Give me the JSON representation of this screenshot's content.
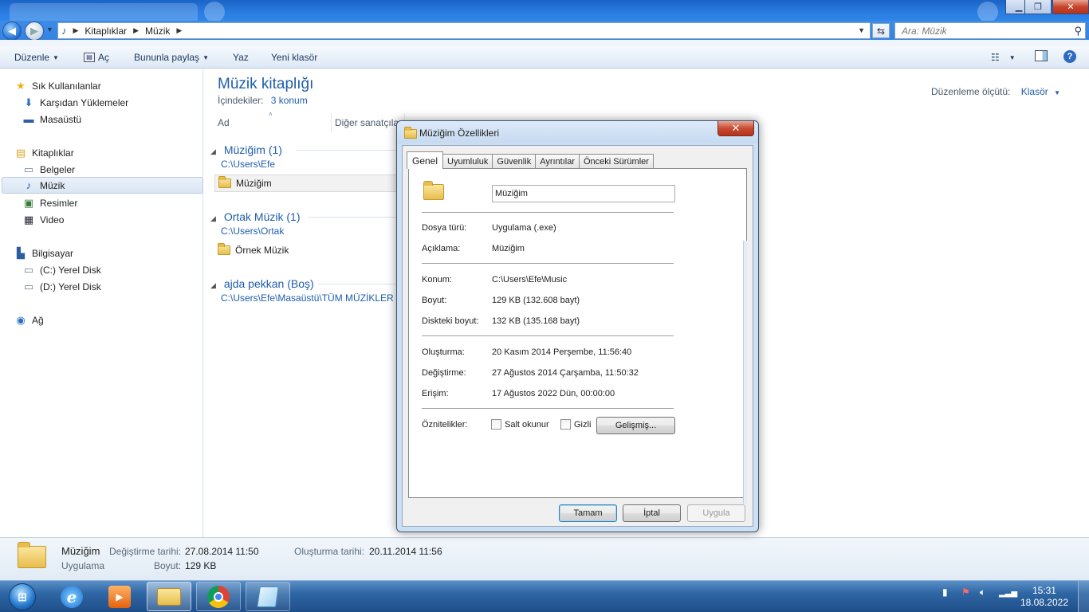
{
  "window": {
    "address": [
      "Kitaplıklar",
      "Müzik"
    ],
    "search_placeholder": "Ara: Müzik"
  },
  "toolbar": {
    "organize": "Düzenle",
    "open": "Aç",
    "share": "Bununla paylaş",
    "print": "Yaz",
    "new_folder": "Yeni klasör"
  },
  "nav": {
    "favorites": "Sık Kullanılanlar",
    "downloads": "Karşıdan Yüklemeler",
    "desktop": "Masaüstü",
    "libraries": "Kitaplıklar",
    "documents": "Belgeler",
    "music": "Müzik",
    "pictures": "Resimler",
    "video": "Video",
    "computer": "Bilgisayar",
    "drive_c": "(C:) Yerel Disk",
    "drive_d": "(D:) Yerel Disk",
    "network": "Ağ"
  },
  "library": {
    "title": "Müzik kitaplığı",
    "includes_label": "İçindekiler:",
    "includes_link": "3 konum",
    "arrange_label": "Düzenleme ölçütü:",
    "arrange_value": "Klasör",
    "columns": [
      "Ad",
      "Diğer sanatçılar"
    ],
    "groups": [
      {
        "header": "Müziğim (1)",
        "path": "C:\\Users\\Efe",
        "item": "Müziğim"
      },
      {
        "header": "Ortak Müzik (1)",
        "path": "C:\\Users\\Ortak",
        "item": "Örnek Müzik"
      },
      {
        "header": "ajda pekkan (Boş)",
        "path": "C:\\Users\\Efe\\Masaüstü\\TÜM MÜZİKLER"
      }
    ]
  },
  "details": {
    "name": "Müziğim",
    "type": "Uygulama",
    "modified_label": "Değiştirme tarihi:",
    "modified_value": "27.08.2014 11:50",
    "size_label": "Boyut:",
    "size_value": "129 KB",
    "created_label": "Oluşturma tarihi:",
    "created_value": "20.11.2014 11:56"
  },
  "dialog": {
    "title": "Müziğim Özellikleri",
    "tabs": [
      "Genel",
      "Uyumluluk",
      "Güvenlik",
      "Ayrıntılar",
      "Önceki Sürümler"
    ],
    "name_value": "Müziğim",
    "rows": {
      "type_label": "Dosya türü:",
      "type_value": "Uygulama (.exe)",
      "desc_label": "Açıklama:",
      "desc_value": "Müziğim",
      "loc_label": "Konum:",
      "loc_value": "C:\\Users\\Efe\\Music",
      "size_label": "Boyut:",
      "size_value": "129 KB (132.608 bayt)",
      "disk_label": "Diskteki boyut:",
      "disk_value": "132 KB (135.168 bayt)",
      "created_label": "Oluşturma:",
      "created_value": "20 Kasım 2014 Perşembe, 11:56:40",
      "modified_label": "Değiştirme:",
      "modified_value": "27 Ağustos 2014 Çarşamba, 11:50:32",
      "accessed_label": "Erişim:",
      "accessed_value": "17 Ağustos 2022 Dün, 00:00:00",
      "attr_label": "Öznitelikler:"
    },
    "readonly_label": "Salt okunur",
    "hidden_label": "Gizli",
    "advanced_label": "Gelişmiş...",
    "ok_label": "Tamam",
    "cancel_label": "İptal",
    "apply_label": "Uygula"
  },
  "taskbar": {
    "time": "15:31",
    "date": "18.08.2022"
  },
  "icons": {
    "back": "back-arrow-icon",
    "forward": "forward-arrow-icon",
    "search": "magnifier-icon",
    "favorites": "star-icon",
    "music": "music-note-icon",
    "folder": "folder-icon",
    "ie": "internet-explorer-icon",
    "chrome": "chrome-icon"
  }
}
